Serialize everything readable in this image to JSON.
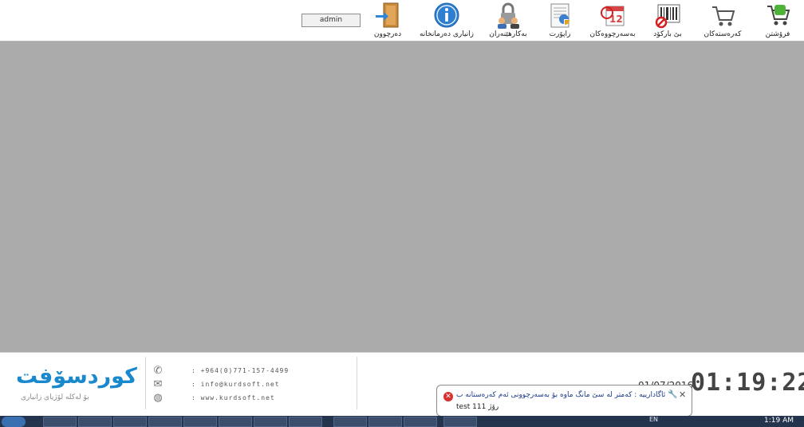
{
  "toolbar": {
    "user": "admin",
    "items": [
      {
        "label": "فرۆشتن",
        "icon": "cart-green-icon"
      },
      {
        "label": "کەرەستەکان",
        "icon": "cart-icon"
      },
      {
        "label": "بێ بارکۆد",
        "icon": "no-barcode-icon"
      },
      {
        "label": "بەسەرچووەکان",
        "icon": "expired-calendar-icon"
      },
      {
        "label": "راپۆرت",
        "icon": "report-icon"
      },
      {
        "label": "بەکارهێنەران",
        "icon": "users-lock-icon"
      },
      {
        "label": "زانیاری دەرمانخانە",
        "icon": "info-icon"
      },
      {
        "label": "دەرچوون",
        "icon": "exit-door-icon"
      }
    ]
  },
  "footer": {
    "logo": "کوردسۆفت",
    "logo_sub": "بۆ لەکلە لۆژیای زانیاری",
    "phone": ": +964(0)771-157-4499",
    "email": ": info@kurdsoft.net",
    "website": ": www.kurdsoft.net",
    "date": "01/07/2016",
    "clock": "01:19:22"
  },
  "notification": {
    "title": "ئاگادارییە : کەمتر لە سێ مانگ ماوە بۆ بەسەرچوونی ئەم کەرەستانە ب",
    "message": "test 111  رۆژ"
  },
  "taskbar": {
    "language": "EN",
    "time": "1:19 AM"
  },
  "colors": {
    "main_bg": "#ababab",
    "logo_blue": "#1a88cc",
    "taskbar": "#24344d"
  }
}
